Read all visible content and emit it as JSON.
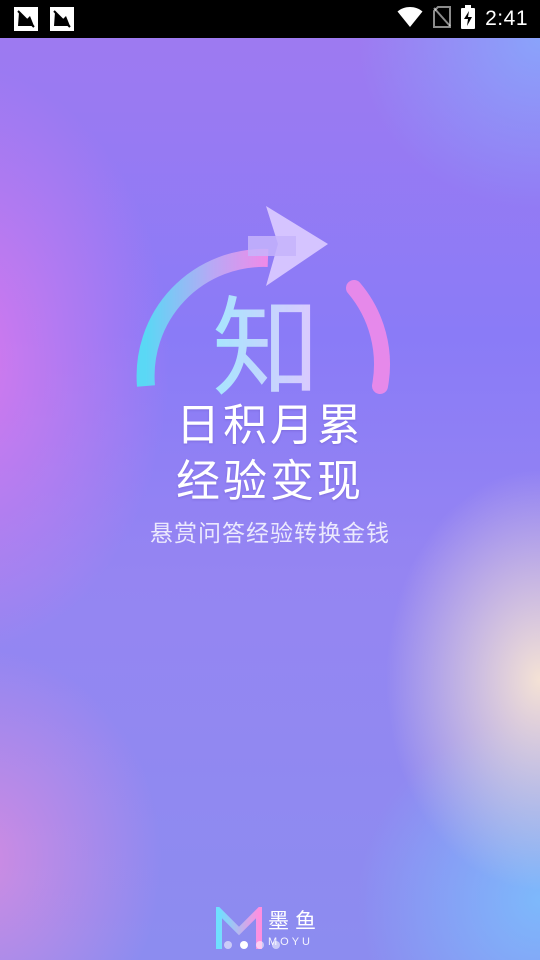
{
  "status_bar": {
    "time": "2:41",
    "icons": [
      "notification-app-icon",
      "notification-app-icon",
      "wifi-icon",
      "no-sim-icon",
      "battery-charging-icon"
    ]
  },
  "hero": {
    "logo_char": "知",
    "headline_line1": "日积月累",
    "headline_line2": "经验变现",
    "subtitle": "悬赏问答经验转换金钱"
  },
  "brand": {
    "name": "墨鱼",
    "name_en": "MOYU"
  },
  "pager": {
    "count": 4,
    "active_index": 1
  },
  "colors": {
    "ring_start": "#5ad8f5",
    "ring_end": "#f08ae8",
    "status_bar_bg": "#000000"
  }
}
